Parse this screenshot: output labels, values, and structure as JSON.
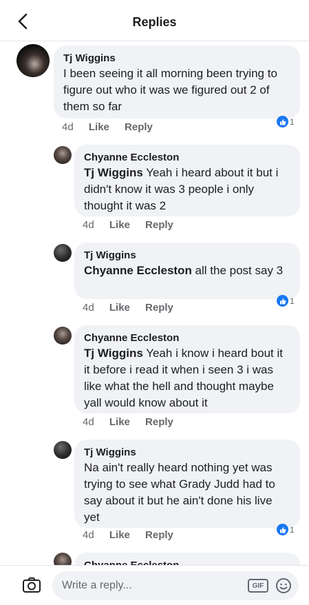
{
  "header": {
    "title": "Replies",
    "back_icon": "chevron-left-icon"
  },
  "comments": [
    {
      "author": "Tj Wiggins",
      "mention": "",
      "text": "I been seeing it all morning been trying to figure out who it was we figured out 2 of them so far",
      "time": "4d",
      "like": "Like",
      "reply": "Reply",
      "reactions": "1"
    },
    {
      "author": "Chyanne Eccleston",
      "mention": "Tj Wiggins",
      "text": " Yeah i heard about it but i didn't know it was 3 people i only thought it was 2",
      "time": "4d",
      "like": "Like",
      "reply": "Reply",
      "reactions": ""
    },
    {
      "author": "Tj Wiggins",
      "mention": "Chyanne Eccleston",
      "text": " all the post say 3",
      "time": "4d",
      "like": "Like",
      "reply": "Reply",
      "reactions": "1"
    },
    {
      "author": "Chyanne Eccleston",
      "mention": "Tj Wiggins",
      "text": " Yeah i know i heard bout it it before i read it when i seen 3 i was like what the hell and thought maybe yall would know about it",
      "time": "4d",
      "like": "Like",
      "reply": "Reply",
      "reactions": ""
    },
    {
      "author": "Tj Wiggins",
      "mention": "",
      "text": "Na ain't really heard nothing yet was trying to see what Grady Judd had to say about it but he ain't done his live yet",
      "time": "4d",
      "like": "Like",
      "reply": "Reply",
      "reactions": "1"
    },
    {
      "author": "Chyanne Eccleston"
    }
  ],
  "composer": {
    "placeholder": "Write a reply...",
    "gif_label": "GIF",
    "camera_icon": "camera-icon",
    "emoji_icon": "emoji-icon"
  },
  "colors": {
    "reaction_blue": "#1877f2",
    "bubble_bg": "#f0f2f5",
    "meta_gray": "#65676b"
  }
}
